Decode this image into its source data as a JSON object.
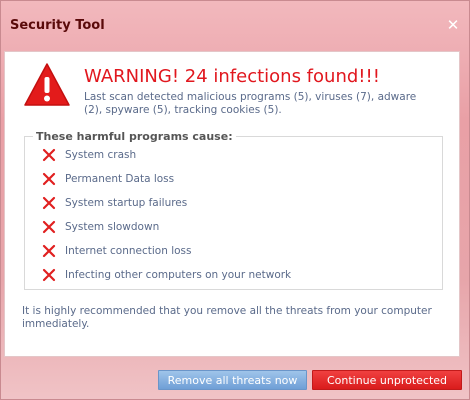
{
  "window": {
    "title": "Security Tool",
    "close_glyph": "✕"
  },
  "alert": {
    "icon": "warning-triangle-icon",
    "headline": "WARNING! 24 infections found!!!",
    "description": "Last scan detected malicious programs (5), viruses (7), adware (2), spyware (5), tracking cookies (5)."
  },
  "causes": {
    "title": "These harmful programs cause:",
    "icon": "red-x-icon",
    "items": [
      "System crash",
      "Permanent Data loss",
      "System startup failures",
      "System slowdown",
      "Internet connection loss",
      "Infecting other computers on your network"
    ]
  },
  "recommendation": "It is highly recommended that you remove all the threats from your computer immediately.",
  "buttons": {
    "remove_label": "Remove all threats now",
    "continue_label": "Continue unprotected"
  },
  "colors": {
    "headline": "#e1171e",
    "remove_button": "#7faee0",
    "continue_button": "#e52727"
  }
}
